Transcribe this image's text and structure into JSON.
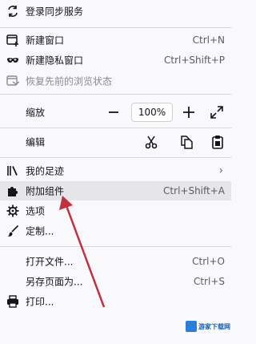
{
  "menu": {
    "sign_in": "登录同步服务",
    "new_window": {
      "label": "新建窗口",
      "shortcut": "Ctrl+N"
    },
    "new_private_window": {
      "label": "新建隐私窗口",
      "shortcut": "Ctrl+Shift+P"
    },
    "restore_session": "恢复先前的浏览状态",
    "zoom": {
      "label": "缩放",
      "minus": "−",
      "value": "100%",
      "plus": "+"
    },
    "edit": {
      "label": "编辑"
    },
    "library": "我的足迹",
    "addons": {
      "label": "附加组件",
      "shortcut": "Ctrl+Shift+A"
    },
    "options": "选项",
    "customize": "定制...",
    "open_file": {
      "label": "打开文件...",
      "shortcut": "Ctrl+O"
    },
    "save_as": {
      "label": "另存页面为...",
      "shortcut": "Ctrl+S"
    },
    "print": "打印..."
  },
  "watermark": "游家下载网",
  "colors": {
    "background": "#f9f9fb",
    "hover": "#e6e6ea",
    "arrow": "#c0323f",
    "watermark": "#2b7fd9"
  },
  "icons": [
    "sync-icon",
    "new-window-icon",
    "private-mask-icon",
    "restore-icon",
    "fullscreen-icon",
    "cut-icon",
    "copy-icon",
    "paste-icon",
    "library-icon",
    "puzzle-icon",
    "gear-icon",
    "brush-icon",
    "printer-icon"
  ]
}
